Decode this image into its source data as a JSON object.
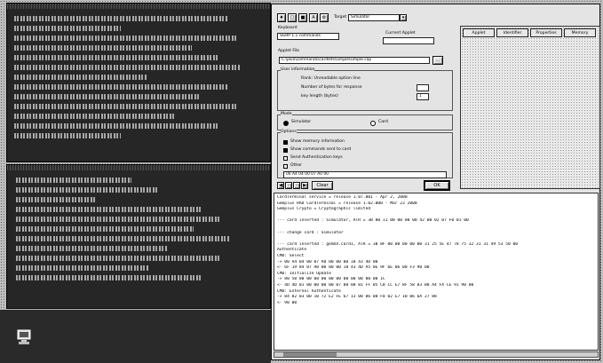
{
  "colors": {
    "desktop": "#c9c9c9",
    "console_bg": "#161616",
    "panel": "#e4e4e4",
    "log_bg": "#ffffff"
  },
  "toolbar": {
    "target_label": "Target",
    "target_value": "Simulator"
  },
  "form": {
    "keyboard_label": "Keyboard",
    "keyboard_value": "SGRP 1.1 commands",
    "current_label": "Current Applet",
    "applet_file_label": "Applet File",
    "applet_path": "C:\\java\\commands\\cardlets\\simple\\simple.cap",
    "browse_button": "...",
    "user_info_label": "User information",
    "user_info_1": "Rank: Unreadable option line",
    "user_info_2": "Number of bytes for response",
    "user_info_3": "key length (bytes)",
    "value_2": "1",
    "mode_label": "Mode",
    "radio_simulator": "Simulator",
    "radio_card": "Card",
    "options_label": "Options",
    "option_1": "Show memory information",
    "option_2": "Show commands sent to card",
    "option_3": "Send Authentication keys",
    "option_4": "Other",
    "apdu_value": "00 A4 04 00 07 A0 00",
    "clear_button": "Clear",
    "ok_button": "OK"
  },
  "tabs": [
    "Applet",
    "Identifier",
    "Properties",
    "Memory"
  ],
  "log": {
    "lines": [
      "CardTerminal service = release 1.07.001 - Apr 2, 2000",
      "Gemplus RAD CardTerminal = release 1.02.000 - Mar 23 2000",
      "Gemplus Crypto = Cryptographic limited",
      "",
      "--- card inserted : Simulator,  ATR = 3B 8B 11 00 00 00 00 42 00 02 07 F0 01 00",
      "",
      "--- change card : Simulator",
      "",
      "--- card inserted : gemXX.card1,  ATR = 3B 8F 00 00 00 00 00 31 25 5E 47 78 75 32 31 31 49 53 50 00",
      "Authenticate",
      "CMD: Select",
      "-> 00 A4 04 00 07 A0 00 00 00 18 43 4D 00",
      "<- 6F 19 84 07 A0 00 00 00 18 43 4D A5 0E 9F 6E 06 00 F3 90 00",
      "CMD: Initialize Update",
      "-> 80 50 00 00 08 00 00 00 00 00 00 00 00 1C",
      "<- 4D 4D 01 00 00 00 00 07 00 00 01 FF 05 CB CC E7 8F 58 83 B8 A4 FA CE 91 90 00",
      "CMD: External Authenticate",
      "-> 84 82 03 00 10 72 E2 FE 67 13 00 86 08 F0 02 E7 1B 06 6A 27 88",
      "<- 90 00"
    ]
  }
}
